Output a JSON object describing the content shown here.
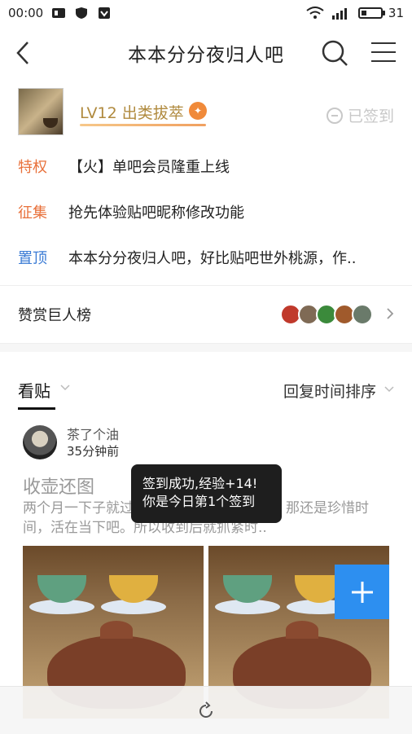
{
  "status_bar": {
    "time": "00:00",
    "network": "4G",
    "battery": "31"
  },
  "nav": {
    "title": "本本分分夜归人吧"
  },
  "forum": {
    "level": "LV12 出类拔萃",
    "signed": "已签到"
  },
  "notices": [
    {
      "tag": "特权",
      "tag_color": "#e8703a",
      "text": "【火】单吧会员隆重上线"
    },
    {
      "tag": "征集",
      "tag_color": "#e8703a",
      "text": "抢先体验贴吧昵称修改功能"
    },
    {
      "tag": "置顶",
      "tag_color": "#3a7bd5",
      "text": "本本分分夜归人吧，好比贴吧世外桃源，作.."
    }
  ],
  "reward": {
    "label": "赞赏巨人榜"
  },
  "tabs": {
    "watch": "看贴",
    "sort": "回复时间排序"
  },
  "post": {
    "user": "茶了个油",
    "time": "35分钟前",
    "title": "收壶还图",
    "body": "两个月一下子就过去了，时间如流光匆匆，那还是珍惜时间，活在当下吧。所以收到后就抓紧时.."
  },
  "toast": {
    "line1": "签到成功,经验+14!",
    "line2": "你是今日第1个签到"
  },
  "colors": {
    "accent": "#2d8ff0",
    "level": "#b08a3e"
  }
}
